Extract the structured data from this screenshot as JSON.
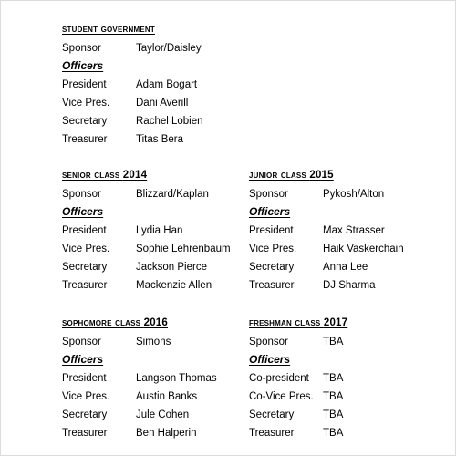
{
  "document": {
    "sections": [
      {
        "id": "student-government",
        "title_caps": "Student Government",
        "title_number": "",
        "officers_label": "Officers",
        "sponsor": {
          "label": "Sponsor",
          "value": "Taylor/Daisley"
        },
        "officers": [
          {
            "label": "President",
            "value": "Adam Bogart"
          },
          {
            "label": "Vice Pres.",
            "value": "Dani Averill"
          },
          {
            "label": "Secretary",
            "value": "Rachel Lobien"
          },
          {
            "label": "Treasurer",
            "value": "Titas Bera"
          }
        ]
      },
      {
        "id": "senior-class-2014",
        "title_caps": "Senior Class ",
        "title_number": "2014",
        "officers_label": "Officers",
        "sponsor": {
          "label": "Sponsor",
          "value": "Blizzard/Kaplan"
        },
        "officers": [
          {
            "label": "President",
            "value": "Lydia Han"
          },
          {
            "label": "Vice Pres.",
            "value": "Sophie Lehrenbaum"
          },
          {
            "label": "Secretary",
            "value": "Jackson Pierce"
          },
          {
            "label": "Treasurer",
            "value": "Mackenzie Allen"
          }
        ]
      },
      {
        "id": "junior-class-2015",
        "title_caps": "Junior Class ",
        "title_number": "2015",
        "officers_label": "Officers",
        "sponsor": {
          "label": "Sponsor",
          "value": "Pykosh/Alton"
        },
        "officers": [
          {
            "label": "President",
            "value": "Max Strasser"
          },
          {
            "label": "Vice Pres.",
            "value": "Haik Vaskerchain"
          },
          {
            "label": "Secretary",
            "value": "Anna Lee"
          },
          {
            "label": "Treasurer",
            "value": "DJ Sharma"
          }
        ]
      },
      {
        "id": "sophomore-class-2016",
        "title_caps": "Sophomore Class ",
        "title_number": "2016",
        "officers_label": "Officers",
        "sponsor": {
          "label": "Sponsor",
          "value": "Simons"
        },
        "officers": [
          {
            "label": "President",
            "value": "Langson Thomas"
          },
          {
            "label": "Vice Pres.",
            "value": "Austin Banks"
          },
          {
            "label": "Secretary",
            "value": "Jule Cohen"
          },
          {
            "label": "Treasurer",
            "value": "Ben Halperin"
          }
        ]
      },
      {
        "id": "freshman-class-2017",
        "title_caps": "Freshman Class ",
        "title_number": "2017",
        "officers_label": "Officers",
        "sponsor": {
          "label": "Sponsor",
          "value": "TBA"
        },
        "officers": [
          {
            "label": "Co-president",
            "value": "TBA"
          },
          {
            "label": "Co-Vice Pres.",
            "value": "TBA"
          },
          {
            "label": "Secretary",
            "value": "TBA"
          },
          {
            "label": "Treasurer",
            "value": "TBA"
          }
        ]
      }
    ]
  }
}
